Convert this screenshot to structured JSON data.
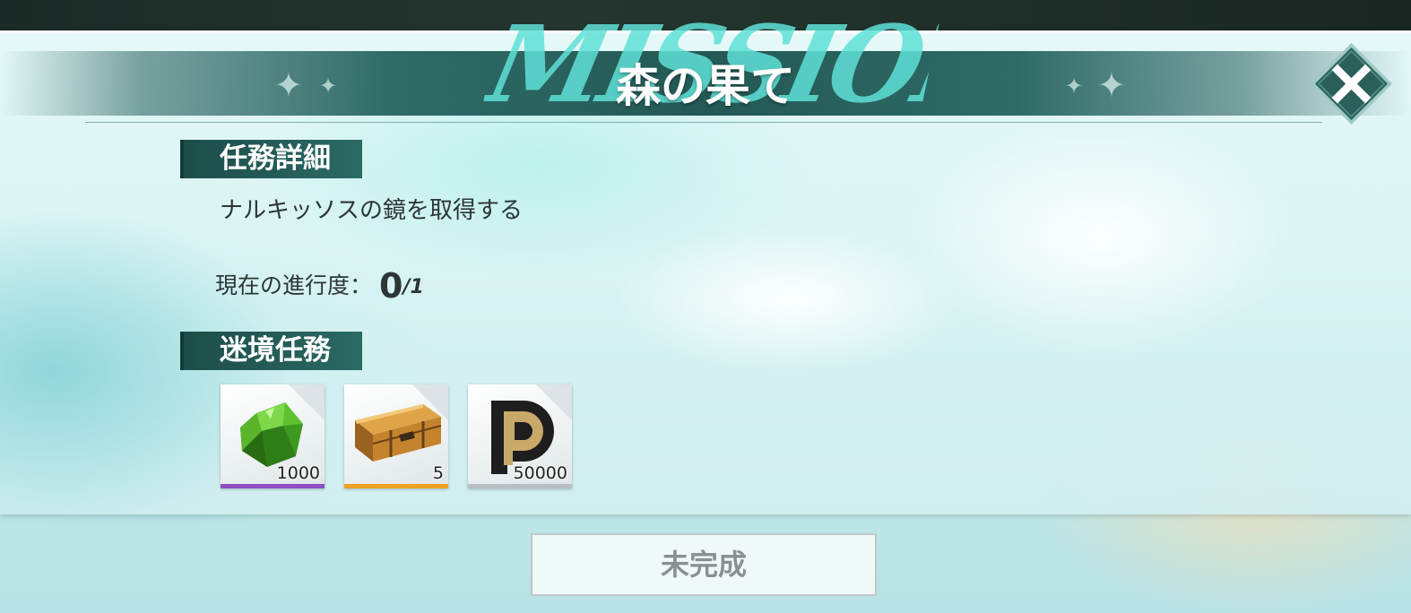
{
  "header": {
    "watermark": "MISSION",
    "title": "森の果て"
  },
  "mission_details": {
    "heading": "任務詳細",
    "description": "ナルキッソスの鏡を取得する",
    "progress_label": "現在の進行度：",
    "progress_current": "0",
    "progress_total": "/1"
  },
  "rewards": {
    "heading": "迷境任務",
    "items": [
      {
        "icon": "green-gem-icon",
        "count": "1000",
        "rarity_color": "#8e4fc4"
      },
      {
        "icon": "treasure-chest-icon",
        "count": "5",
        "rarity_color": "#f0a022"
      },
      {
        "icon": "coin-p-icon",
        "count": "50000",
        "rarity_color": "#b8bec2"
      }
    ]
  },
  "footer": {
    "status_button": "未完成"
  },
  "colors": {
    "band": "#2e6a66",
    "close_button": "#2a5f5a",
    "section_heading": "#1d4d49"
  }
}
